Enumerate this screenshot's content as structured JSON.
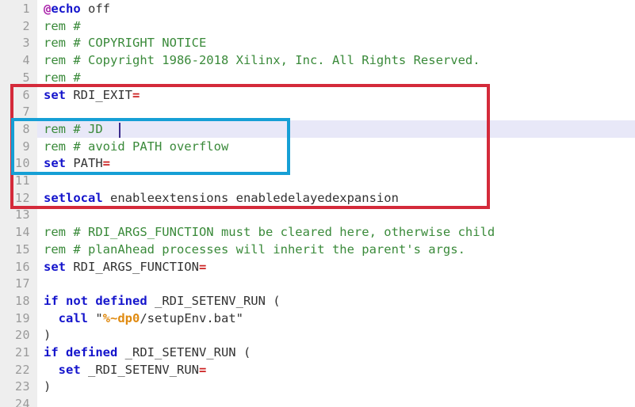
{
  "editor": {
    "title": "setupEnv batch script editor",
    "gutter_bg": "#eeeeee",
    "line_number_color": "#9a9a9a",
    "current_line_bg": "#e8e8f8",
    "background": "#ffffff",
    "caret_color": "#3a2b8c",
    "first_visible_line": 1,
    "last_visible_line": 24
  },
  "colors": {
    "keyword": "#1414cc",
    "comment": "#3a8a3a",
    "operator": "#cc2222",
    "at_sign": "#aa22aa",
    "variable": "#e08a10",
    "plain_text": "#333333",
    "annotation_red": "#d42a3a",
    "annotation_cyan": "#169fd5"
  },
  "line_numbers": [
    "1",
    "2",
    "3",
    "4",
    "5",
    "6",
    "7",
    "8",
    "9",
    "10",
    "11",
    "12",
    "13",
    "14",
    "15",
    "16",
    "17",
    "18",
    "19",
    "20",
    "21",
    "22",
    "23",
    "24"
  ],
  "lines": [
    {
      "num": "1",
      "tokens": [
        {
          "t": "@",
          "c": "at"
        },
        {
          "t": "echo",
          "c": "kw"
        },
        {
          "t": " off",
          "c": "plain"
        }
      ]
    },
    {
      "num": "2",
      "tokens": [
        {
          "t": "rem #",
          "c": "cmt"
        }
      ]
    },
    {
      "num": "3",
      "tokens": [
        {
          "t": "rem # COPYRIGHT NOTICE",
          "c": "cmt"
        }
      ]
    },
    {
      "num": "4",
      "tokens": [
        {
          "t": "rem # Copyright 1986-2018 Xilinx, Inc. All Rights Reserved.",
          "c": "cmt"
        }
      ]
    },
    {
      "num": "5",
      "tokens": [
        {
          "t": "rem #",
          "c": "cmt"
        }
      ]
    },
    {
      "num": "6",
      "tokens": [
        {
          "t": "set",
          "c": "kw"
        },
        {
          "t": " RDI_EXIT",
          "c": "plain"
        },
        {
          "t": "=",
          "c": "op"
        }
      ]
    },
    {
      "num": "7",
      "tokens": []
    },
    {
      "num": "8",
      "tokens": [
        {
          "t": "rem # JD",
          "c": "cmt"
        }
      ]
    },
    {
      "num": "9",
      "tokens": [
        {
          "t": "rem # avoid PATH overflow",
          "c": "cmt"
        }
      ]
    },
    {
      "num": "10",
      "tokens": [
        {
          "t": "set",
          "c": "kw"
        },
        {
          "t": " PATH",
          "c": "plain"
        },
        {
          "t": "=",
          "c": "op"
        }
      ]
    },
    {
      "num": "11",
      "tokens": []
    },
    {
      "num": "12",
      "tokens": [
        {
          "t": "setlocal",
          "c": "kw"
        },
        {
          "t": " enableextensions enabledelayedexpansion",
          "c": "plain"
        }
      ]
    },
    {
      "num": "13",
      "tokens": []
    },
    {
      "num": "14",
      "tokens": [
        {
          "t": "rem # RDI_ARGS_FUNCTION must be cleared here, otherwise child",
          "c": "cmt"
        }
      ]
    },
    {
      "num": "15",
      "tokens": [
        {
          "t": "rem # planAhead processes will inherit the parent's args.",
          "c": "cmt"
        }
      ]
    },
    {
      "num": "16",
      "tokens": [
        {
          "t": "set",
          "c": "kw"
        },
        {
          "t": " RDI_ARGS_FUNCTION",
          "c": "plain"
        },
        {
          "t": "=",
          "c": "op"
        }
      ]
    },
    {
      "num": "17",
      "tokens": []
    },
    {
      "num": "18",
      "tokens": [
        {
          "t": "if not defined",
          "c": "kw"
        },
        {
          "t": " _RDI_SETENV_RUN (",
          "c": "plain"
        }
      ]
    },
    {
      "num": "19",
      "tokens": [
        {
          "t": "  ",
          "c": "plain"
        },
        {
          "t": "call",
          "c": "kw"
        },
        {
          "t": " \"",
          "c": "plain"
        },
        {
          "t": "%~dp0",
          "c": "var"
        },
        {
          "t": "/setupEnv.bat\"",
          "c": "plain"
        }
      ]
    },
    {
      "num": "20",
      "tokens": [
        {
          "t": ")",
          "c": "plain"
        }
      ]
    },
    {
      "num": "21",
      "tokens": [
        {
          "t": "if defined",
          "c": "kw"
        },
        {
          "t": " _RDI_SETENV_RUN (",
          "c": "plain"
        }
      ]
    },
    {
      "num": "22",
      "tokens": [
        {
          "t": "  ",
          "c": "plain"
        },
        {
          "t": "set",
          "c": "kw"
        },
        {
          "t": " _RDI_SETENV_RUN",
          "c": "plain"
        },
        {
          "t": "=",
          "c": "op"
        }
      ]
    },
    {
      "num": "23",
      "tokens": [
        {
          "t": ")",
          "c": "plain"
        }
      ]
    },
    {
      "num": "24",
      "tokens": []
    }
  ],
  "current_line": {
    "number": "8",
    "text": "rem # JD",
    "caret_after": "JD"
  },
  "annotations": [
    {
      "name": "red-highlight-box",
      "color": "#d42a3a",
      "covers_lines": [
        "6",
        "7",
        "8",
        "9",
        "10",
        "11",
        "12"
      ]
    },
    {
      "name": "cyan-highlight-box",
      "color": "#169fd5",
      "covers_lines": [
        "8",
        "9",
        "10"
      ]
    }
  ]
}
